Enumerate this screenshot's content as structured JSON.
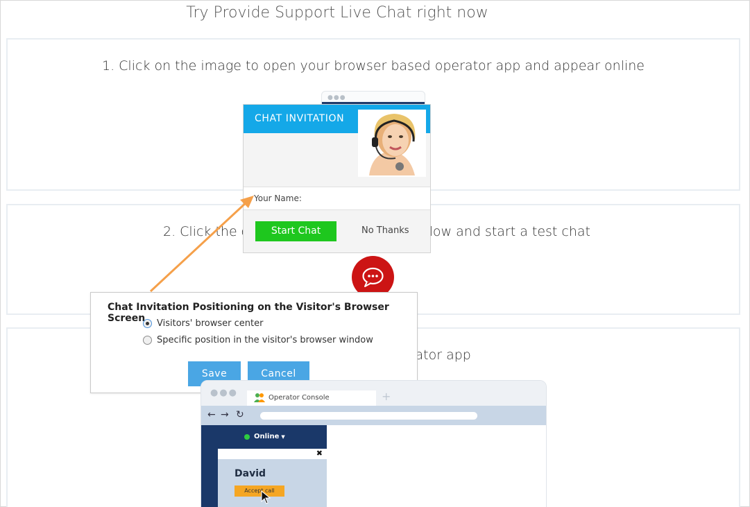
{
  "page": {
    "title": "Try Provide Support Live Chat right now"
  },
  "steps": [
    {
      "text": "1. Click on the image to open your browser based operator app and appear online"
    },
    {
      "text": "2. Click the chat button to open chat window and start a test chat"
    },
    {
      "text": "erator app"
    }
  ],
  "step2_visible": {
    "left": "2. Click the cha",
    "right": "ndow and start a test chat"
  },
  "invitation": {
    "header_title": "CHAT INVITATION",
    "name_label": "Your Name:",
    "start_chat_label": "Start Chat",
    "no_thanks_label": "No Thanks",
    "header_color": "#14a8e8",
    "start_color": "#1ec71e"
  },
  "positioning_dialog": {
    "title": "Chat Invitation Positioning on the Visitor's Browser Screen",
    "options": [
      {
        "label": "Visitors' browser center",
        "selected": true
      },
      {
        "label": "Specific position in the visitor's browser window",
        "selected": false
      }
    ],
    "save_label": "Save",
    "cancel_label": "Cancel",
    "button_color": "#4aa6e4"
  },
  "operator_console": {
    "tab_label": "Operator Console",
    "status": "Online",
    "caller_name": "David",
    "accept_label": "Accept call"
  },
  "icons": {
    "chat_bubble": "chat-bubble-icon",
    "arrow_color": "#f5a04a"
  }
}
